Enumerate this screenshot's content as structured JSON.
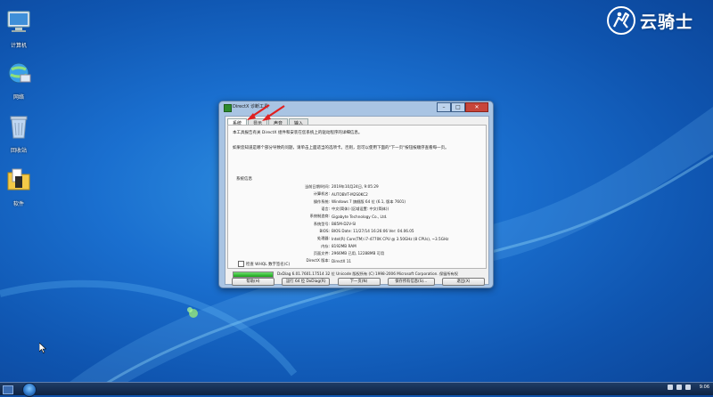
{
  "desktop": {
    "icons": [
      {
        "label": "计算机",
        "icon": "computer-icon"
      },
      {
        "label": "网络",
        "icon": "network-icon"
      },
      {
        "label": "回收站",
        "icon": "recycle-bin-icon"
      },
      {
        "label": "软件",
        "icon": "folder-icon"
      }
    ],
    "brand": {
      "text": "云骑士",
      "icon": "knight-emblem-icon"
    }
  },
  "dialog": {
    "title": "DirectX 诊断工具",
    "tabs": [
      "系统",
      "显示",
      "声音",
      "输入"
    ],
    "active_tab": "系统",
    "intro_line1": "本工具报告有关 DirectX 组件和安装在您系统上的驱动程序的详细信息。",
    "intro_line2": "如果您知道是哪个部分导致的问题，请单击上面适当的选项卡。否则，您可以使用下面的\"下一页\"按钮按顺序查看每一页。",
    "sysinfo_title": "系统信息",
    "rows": [
      {
        "key": "当前日期/时间:",
        "value": "2019年10月24日, 9:05:29"
      },
      {
        "key": "计算机名:",
        "value": "AUTOBVT-M2S0KC2"
      },
      {
        "key": "操作系统:",
        "value": "Windows 7 旗舰版 64 位 (6.1, 版本 7601)"
      },
      {
        "key": "语言:",
        "value": "中文(简体) (区域设置: 中文(简体))"
      },
      {
        "key": "系统制造商:",
        "value": "Gigabyte Technology Co., Ltd."
      },
      {
        "key": "系统型号:",
        "value": "B85M-D2V-SI"
      },
      {
        "key": "BIOS:",
        "value": "BIOS Date: 11/27/14 16:26:06 Ver: 04.06.05"
      },
      {
        "key": "处理器:",
        "value": "Intel(R) Core(TM) i7-4770K CPU @ 3.50GHz (8 CPUs), ~3.5GHz"
      },
      {
        "key": "内存:",
        "value": "8192MB RAM"
      },
      {
        "key": "页面文件:",
        "value": "2966MB 已用, 12288MB 可用"
      },
      {
        "key": "DirectX 版本:",
        "value": "DirectX 11"
      }
    ],
    "whql_checkbox": "检查 WHQL 数字签名(C)",
    "progress_percent": 100,
    "copyright": "DxDiag 6.01.7601.17514 32 位 Unicode 版权所有 (C) 1998-2006 Microsoft Corporation. 保留所有权",
    "buttons": {
      "help": "帮助(H)",
      "run64": "运行 64 位 DxDiag(R)",
      "next": "下一页(N)",
      "save": "保存所有信息(S)...",
      "exit": "退出(X)"
    },
    "window_buttons": {
      "min": "–",
      "max": "□",
      "close": "✕"
    }
  },
  "taskbar": {
    "clock": "9:06"
  },
  "colors": {
    "annotation_arrow": "#e02020",
    "desktop_blue": "#1a6fcf"
  }
}
